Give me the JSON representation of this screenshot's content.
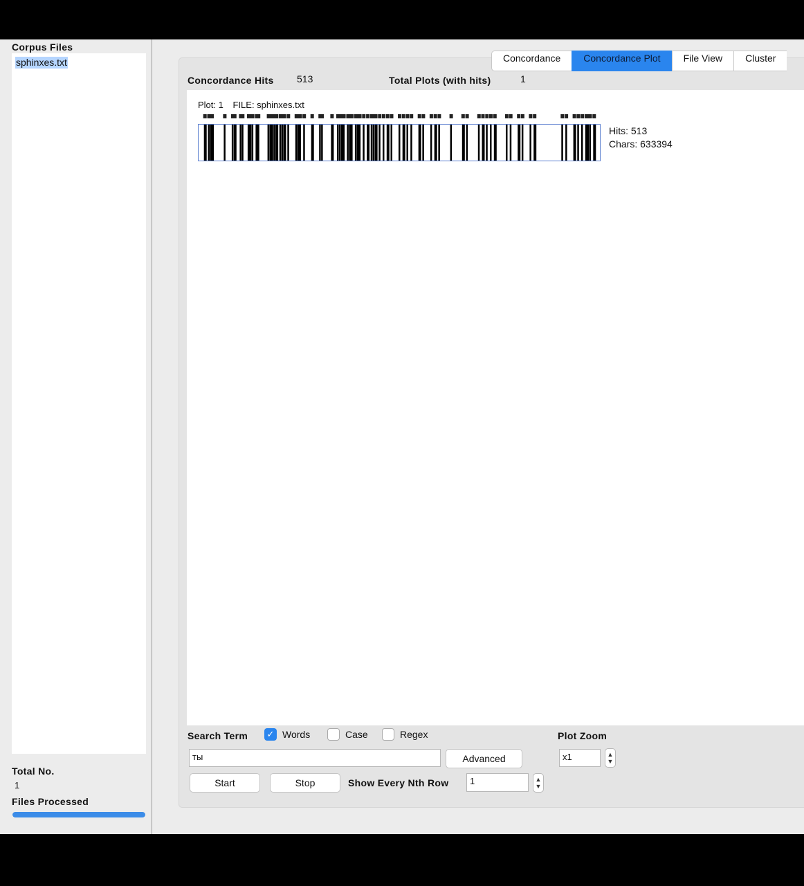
{
  "left_panel": {
    "title": "Corpus Files",
    "files": [
      "sphinxes.txt"
    ],
    "total_label": "Total No.",
    "total_value": "1",
    "processed_label": "Files Processed",
    "progress": 1.0
  },
  "tabs": [
    {
      "label": "Concordance",
      "active": false
    },
    {
      "label": "Concordance Plot",
      "active": true
    },
    {
      "label": "File View",
      "active": false
    },
    {
      "label": "Cluster",
      "active": false
    }
  ],
  "stats": {
    "hits_label": "Concordance Hits",
    "hits_value": "513",
    "plots_label": "Total Plots (with hits)",
    "plots_value": "1"
  },
  "plot": {
    "plot_label": "Plot: 1",
    "file_label": "FILE: sphinxes.txt",
    "hits_text": "Hits: 513",
    "chars_text": "Chars: 633394",
    "total_chars": 633394,
    "hit_positions": [
      0.01,
      0.02,
      0.025,
      0.028,
      0.06,
      0.08,
      0.085,
      0.1,
      0.105,
      0.12,
      0.125,
      0.13,
      0.14,
      0.145,
      0.17,
      0.175,
      0.18,
      0.185,
      0.19,
      0.2,
      0.205,
      0.21,
      0.22,
      0.24,
      0.245,
      0.25,
      0.26,
      0.28,
      0.3,
      0.305,
      0.33,
      0.345,
      0.35,
      0.355,
      0.36,
      0.37,
      0.375,
      0.38,
      0.39,
      0.395,
      0.4,
      0.41,
      0.42,
      0.43,
      0.435,
      0.44,
      0.45,
      0.46,
      0.47,
      0.48,
      0.5,
      0.51,
      0.52,
      0.53,
      0.55,
      0.56,
      0.58,
      0.59,
      0.6,
      0.63,
      0.66,
      0.67,
      0.7,
      0.71,
      0.72,
      0.73,
      0.74,
      0.77,
      0.78,
      0.8,
      0.81,
      0.83,
      0.84,
      0.91,
      0.92,
      0.94,
      0.95,
      0.96,
      0.97,
      0.975,
      0.98,
      0.99
    ]
  },
  "search": {
    "label": "Search Term",
    "words_label": "Words",
    "words_checked": true,
    "case_label": "Case",
    "case_checked": false,
    "regex_label": "Regex",
    "regex_checked": false,
    "term_value": "ты",
    "advanced_label": "Advanced",
    "start_label": "Start",
    "stop_label": "Stop",
    "nth_label": "Show Every Nth Row",
    "nth_value": "1"
  },
  "zoom": {
    "label": "Plot Zoom",
    "value": "x1"
  },
  "icons": {
    "check": "✓",
    "stepper_up": "▲",
    "stepper_down": "▼"
  }
}
